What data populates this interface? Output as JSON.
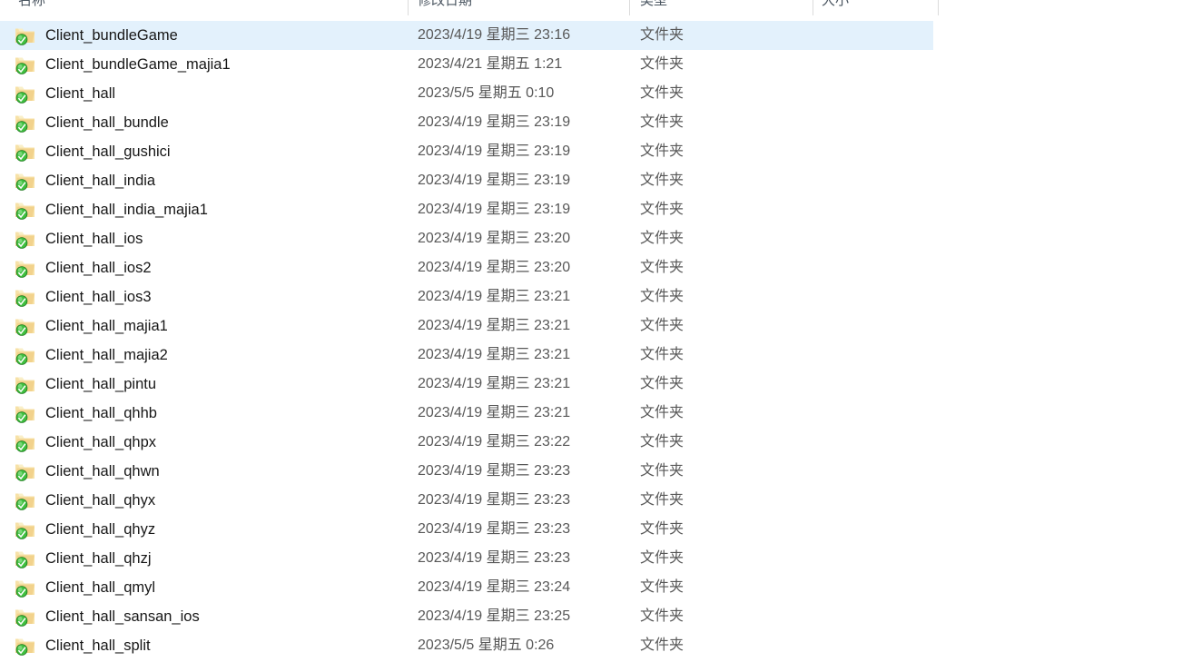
{
  "window": {
    "view_mode": "details",
    "accent_selection_color": "#e3f1fc",
    "folder_icon_color": "#f0cf7e",
    "overlay_icon_color": "#2faa2f"
  },
  "columns": {
    "headers": [
      {
        "key": "name",
        "label": "名称",
        "icon": "column-header-name"
      },
      {
        "key": "date",
        "label": "修改日期",
        "icon": "column-header-date"
      },
      {
        "key": "type",
        "label": "类型",
        "icon": "column-header-type"
      },
      {
        "key": "size",
        "label": "大小",
        "icon": "column-header-size"
      }
    ]
  },
  "files": [
    {
      "icon": "folder-svn-normal-icon",
      "name": "Client_bundleGame",
      "date": "2023/4/19 星期三 23:16",
      "type": "文件夹",
      "size": "",
      "selected": true
    },
    {
      "icon": "folder-svn-normal-icon",
      "name": "Client_bundleGame_majia1",
      "date": "2023/4/21 星期五 1:21",
      "type": "文件夹",
      "size": "",
      "selected": false
    },
    {
      "icon": "folder-svn-normal-icon",
      "name": "Client_hall",
      "date": "2023/5/5 星期五 0:10",
      "type": "文件夹",
      "size": "",
      "selected": false
    },
    {
      "icon": "folder-svn-normal-icon",
      "name": "Client_hall_bundle",
      "date": "2023/4/19 星期三 23:19",
      "type": "文件夹",
      "size": "",
      "selected": false
    },
    {
      "icon": "folder-svn-normal-icon",
      "name": "Client_hall_gushici",
      "date": "2023/4/19 星期三 23:19",
      "type": "文件夹",
      "size": "",
      "selected": false
    },
    {
      "icon": "folder-svn-normal-icon",
      "name": "Client_hall_india",
      "date": "2023/4/19 星期三 23:19",
      "type": "文件夹",
      "size": "",
      "selected": false
    },
    {
      "icon": "folder-svn-normal-icon",
      "name": "Client_hall_india_majia1",
      "date": "2023/4/19 星期三 23:19",
      "type": "文件夹",
      "size": "",
      "selected": false
    },
    {
      "icon": "folder-svn-normal-icon",
      "name": "Client_hall_ios",
      "date": "2023/4/19 星期三 23:20",
      "type": "文件夹",
      "size": "",
      "selected": false
    },
    {
      "icon": "folder-svn-normal-icon",
      "name": "Client_hall_ios2",
      "date": "2023/4/19 星期三 23:20",
      "type": "文件夹",
      "size": "",
      "selected": false
    },
    {
      "icon": "folder-svn-normal-icon",
      "name": "Client_hall_ios3",
      "date": "2023/4/19 星期三 23:21",
      "type": "文件夹",
      "size": "",
      "selected": false
    },
    {
      "icon": "folder-svn-normal-icon",
      "name": "Client_hall_majia1",
      "date": "2023/4/19 星期三 23:21",
      "type": "文件夹",
      "size": "",
      "selected": false
    },
    {
      "icon": "folder-svn-normal-icon",
      "name": "Client_hall_majia2",
      "date": "2023/4/19 星期三 23:21",
      "type": "文件夹",
      "size": "",
      "selected": false
    },
    {
      "icon": "folder-svn-normal-icon",
      "name": "Client_hall_pintu",
      "date": "2023/4/19 星期三 23:21",
      "type": "文件夹",
      "size": "",
      "selected": false
    },
    {
      "icon": "folder-svn-normal-icon",
      "name": "Client_hall_qhhb",
      "date": "2023/4/19 星期三 23:21",
      "type": "文件夹",
      "size": "",
      "selected": false
    },
    {
      "icon": "folder-svn-normal-icon",
      "name": "Client_hall_qhpx",
      "date": "2023/4/19 星期三 23:22",
      "type": "文件夹",
      "size": "",
      "selected": false
    },
    {
      "icon": "folder-svn-normal-icon",
      "name": "Client_hall_qhwn",
      "date": "2023/4/19 星期三 23:23",
      "type": "文件夹",
      "size": "",
      "selected": false
    },
    {
      "icon": "folder-svn-normal-icon",
      "name": "Client_hall_qhyx",
      "date": "2023/4/19 星期三 23:23",
      "type": "文件夹",
      "size": "",
      "selected": false
    },
    {
      "icon": "folder-svn-normal-icon",
      "name": "Client_hall_qhyz",
      "date": "2023/4/19 星期三 23:23",
      "type": "文件夹",
      "size": "",
      "selected": false
    },
    {
      "icon": "folder-svn-normal-icon",
      "name": "Client_hall_qhzj",
      "date": "2023/4/19 星期三 23:23",
      "type": "文件夹",
      "size": "",
      "selected": false
    },
    {
      "icon": "folder-svn-normal-icon",
      "name": "Client_hall_qmyl",
      "date": "2023/4/19 星期三 23:24",
      "type": "文件夹",
      "size": "",
      "selected": false
    },
    {
      "icon": "folder-svn-normal-icon",
      "name": "Client_hall_sansan_ios",
      "date": "2023/4/19 星期三 23:25",
      "type": "文件夹",
      "size": "",
      "selected": false
    },
    {
      "icon": "folder-svn-normal-icon",
      "name": "Client_hall_split",
      "date": "2023/5/5 星期五 0:26",
      "type": "文件夹",
      "size": "",
      "selected": false
    }
  ]
}
